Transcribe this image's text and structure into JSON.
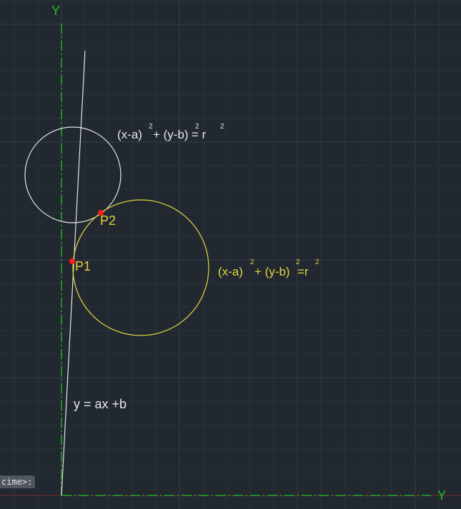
{
  "canvas": {
    "background": "#212830",
    "grid_minor_color": "#2a323b",
    "grid_major_color": "#333c46"
  },
  "axes": {
    "vertical_label": "Y",
    "horizontal_label": "Y",
    "axis_color": "#22c322",
    "baseline_color": "#7a2a36"
  },
  "drawing": {
    "white_color": "#e6e6e6",
    "yellow_color": "#e3d53c",
    "point_color": "#ff1a1a",
    "white_circle_equation": {
      "base1": "(x-a)",
      "exp1": "2",
      "mid": "+ (y-b)",
      "exp2": "2",
      "end": "= r",
      "exp3": "2"
    },
    "yellow_circle_equation": {
      "base1": "(x-a)",
      "exp1": "2",
      "mid": "+ (y-b)",
      "exp2": "2",
      "end": "=r",
      "exp3": "2"
    },
    "line_equation": "y = ax +b",
    "point1_label": "P1",
    "point2_label": "P2"
  },
  "command_line": {
    "prompt_text": "cime>:"
  }
}
